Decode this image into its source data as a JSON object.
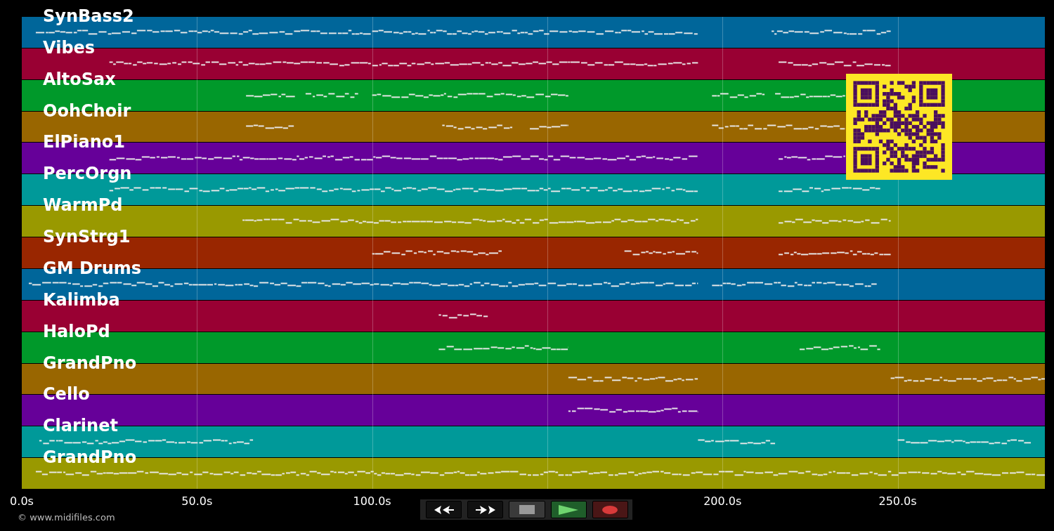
{
  "tracks": [
    {
      "name": "SynBass2",
      "color": "#00669a"
    },
    {
      "name": "Vibes",
      "color": "#990033"
    },
    {
      "name": "AltoSax",
      "color": "#00992a"
    },
    {
      "name": "OohChoir",
      "color": "#996600"
    },
    {
      "name": "ElPiano1",
      "color": "#660099"
    },
    {
      "name": "PercOrgn",
      "color": "#009999"
    },
    {
      "name": "WarmPd",
      "color": "#999900"
    },
    {
      "name": "SynStrg1",
      "color": "#992600"
    },
    {
      "name": "GM Drums",
      "color": "#00669a"
    },
    {
      "name": "Kalimba",
      "color": "#990033"
    },
    {
      "name": "HaloPd",
      "color": "#00992a"
    },
    {
      "name": "GrandPno",
      "color": "#996600"
    },
    {
      "name": "Cello",
      "color": "#660099"
    },
    {
      "name": "Clarinet",
      "color": "#009999"
    },
    {
      "name": "GrandPno",
      "color": "#999900"
    }
  ],
  "time_axis": {
    "ticks": [
      "0.0s",
      "50.0s",
      "100.0s",
      "200.0s",
      "250.0s"
    ]
  },
  "copyright": "© www.midifiles.com"
}
